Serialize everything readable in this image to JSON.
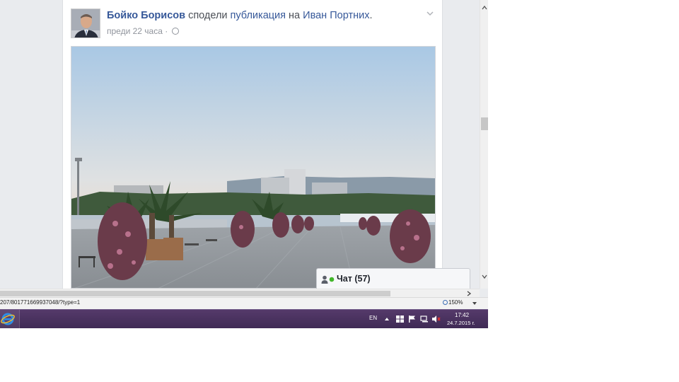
{
  "post": {
    "author": "Бойко Борисов",
    "action": "сподели",
    "object": "публикация",
    "preposition": "на",
    "original_author": "Иван Портних",
    "time": "преди 22 часа",
    "separator": "·",
    "privacy_icon": "globe-icon",
    "period": "."
  },
  "chat": {
    "label": "Чат (57)",
    "icon": "people-online-icon",
    "online_color": "#42b72a"
  },
  "statusbar": {
    "url": "207/801771669937048/?type=1",
    "zoom": "150%"
  },
  "taskbar": {
    "language": "EN",
    "time": "17:42",
    "date": "24.7.2015 г."
  },
  "colors": {
    "link": "#365899",
    "taskbar": "#4a3360",
    "background": "#e9ebee"
  }
}
